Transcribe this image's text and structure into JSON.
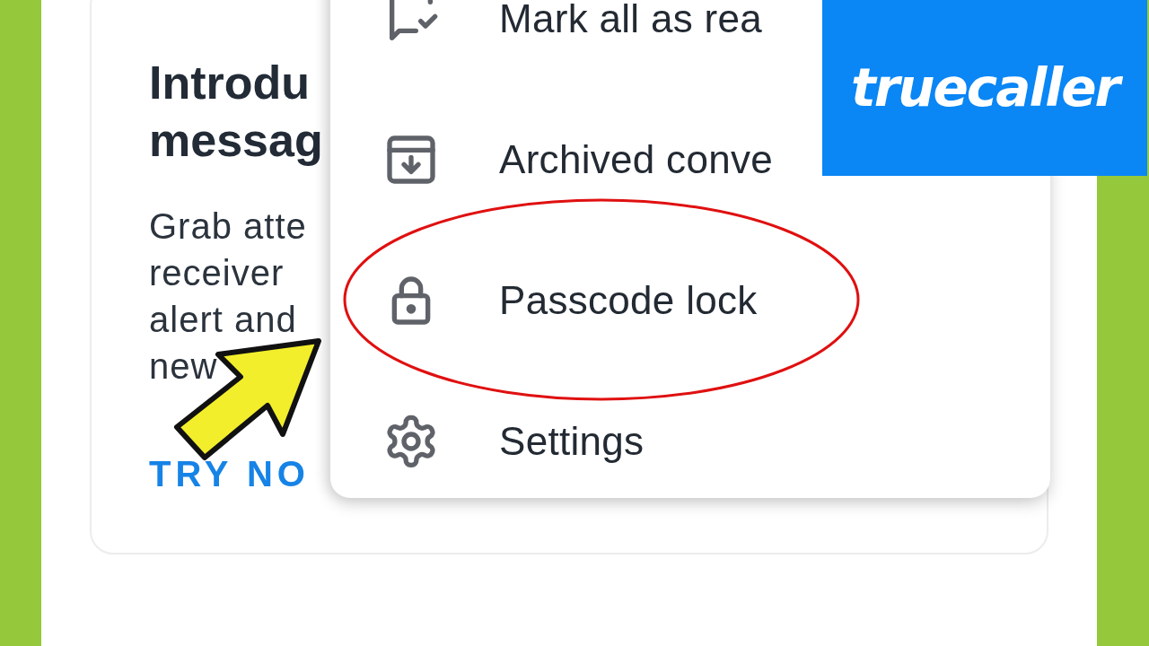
{
  "card": {
    "title_lines": [
      "Introdu",
      "messag"
    ],
    "body_lines": [
      "Grab atte",
      "receiver",
      "alert and",
      "new"
    ],
    "action": "TRY NO"
  },
  "menu": {
    "items": [
      {
        "kind": "mark-read",
        "label": "Mark all as rea",
        "highlighted": false
      },
      {
        "kind": "archive",
        "label": "Archived conve",
        "highlighted": false
      },
      {
        "kind": "lock",
        "label": "Passcode lock",
        "highlighted": true
      },
      {
        "kind": "settings",
        "label": "Settings",
        "highlighted": false
      }
    ]
  },
  "logo": {
    "text": "truecaller"
  }
}
